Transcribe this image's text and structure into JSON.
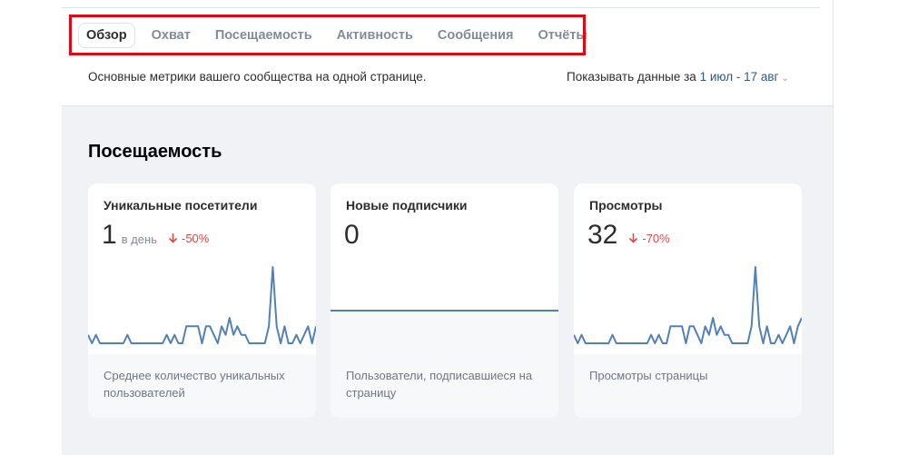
{
  "tabs": [
    {
      "label": "Обзор",
      "active": true
    },
    {
      "label": "Охват"
    },
    {
      "label": "Посещаемость"
    },
    {
      "label": "Активность"
    },
    {
      "label": "Сообщения"
    },
    {
      "label": "Отчёты"
    }
  ],
  "description": "Основные метрики вашего сообщества на одной странице.",
  "period": {
    "prefix": "Показывать данные за",
    "value": "1 июл - 17 авг"
  },
  "section_title": "Посещаемость",
  "colors": {
    "accent": "#2a5885",
    "chart_line": "#5181b8",
    "negative": "#e64646",
    "highlight": "#e30613"
  },
  "cards": [
    {
      "title": "Уникальные посетители",
      "value": "1",
      "unit": "в день",
      "change": "-50%",
      "note": "Среднее количество уникальных пользователей",
      "sparkline": [
        1,
        0,
        1,
        0,
        0,
        0,
        0,
        0,
        0,
        0,
        1,
        0,
        0,
        0,
        0,
        0,
        0,
        0,
        0,
        0,
        1,
        0,
        1,
        0,
        0,
        2,
        2,
        2,
        2,
        0,
        2,
        2,
        1,
        0,
        2,
        1,
        3,
        1,
        2,
        1,
        1,
        0,
        0,
        0,
        0,
        0,
        2,
        9,
        2,
        0,
        2,
        0,
        0,
        1,
        0,
        1,
        2,
        0,
        2
      ]
    },
    {
      "title": "Новые подписчики",
      "value": "0",
      "unit": "",
      "change": "",
      "note": "Пользователи, подписавшиеся на страницу",
      "sparkline": [
        0,
        0,
        0,
        0,
        0,
        0,
        0,
        0,
        0,
        0,
        0,
        0,
        0,
        0,
        0,
        0,
        0,
        0,
        0,
        0,
        0,
        0,
        0,
        0,
        0,
        0,
        0,
        0,
        0,
        0,
        0,
        0,
        0,
        0,
        0,
        0,
        0,
        0,
        0,
        0,
        0,
        0,
        0,
        0,
        0,
        0,
        0,
        0,
        0,
        0
      ]
    },
    {
      "title": "Просмотры",
      "value": "32",
      "unit": "",
      "change": "-70%",
      "note": "Просмотры страницы",
      "sparkline": [
        1,
        0,
        1,
        0,
        0,
        0,
        0,
        0,
        0,
        0,
        1,
        0,
        0,
        0,
        0,
        0,
        0,
        0,
        0,
        0,
        1,
        0,
        1,
        0,
        0,
        2,
        2,
        2,
        2,
        0,
        2,
        2,
        1,
        0,
        2,
        1,
        3,
        1,
        2,
        1,
        1,
        0,
        0,
        0,
        0,
        0,
        2,
        9,
        2,
        0,
        2,
        0,
        0,
        1,
        0,
        1,
        2,
        0,
        2,
        3
      ]
    }
  ]
}
